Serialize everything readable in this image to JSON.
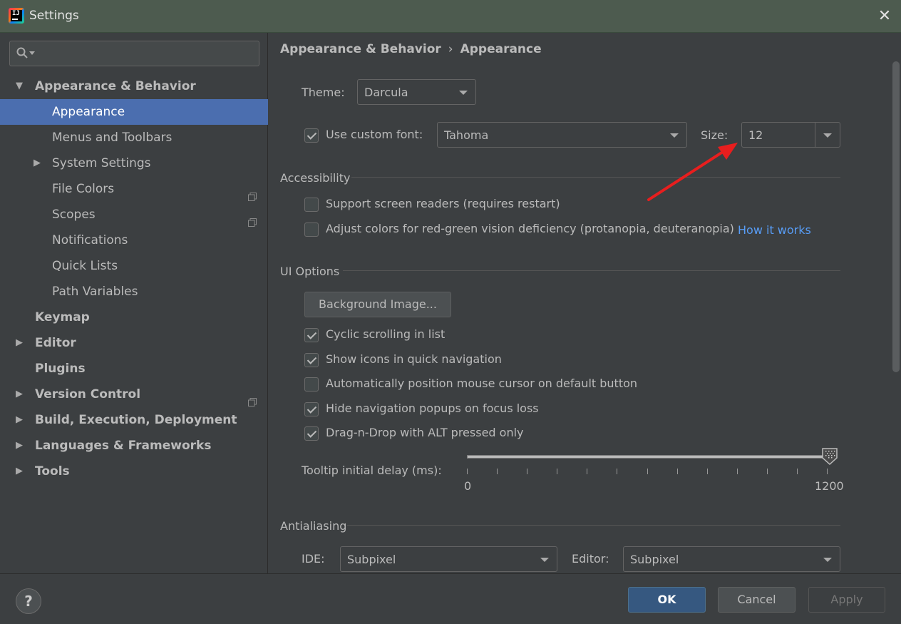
{
  "window": {
    "title": "Settings",
    "close_symbol": "✕"
  },
  "search": {
    "placeholder": ""
  },
  "sidebar": {
    "items": [
      {
        "label": "Appearance & Behavior",
        "level": 0,
        "bold": true,
        "arrow": "▼",
        "selected": false,
        "copy_icon": false
      },
      {
        "label": "Appearance",
        "level": 1,
        "bold": false,
        "arrow": "",
        "selected": true,
        "copy_icon": false
      },
      {
        "label": "Menus and Toolbars",
        "level": 1,
        "bold": false,
        "arrow": "",
        "selected": false,
        "copy_icon": false
      },
      {
        "label": "System Settings",
        "level": 1,
        "bold": false,
        "arrow": "▶",
        "selected": false,
        "copy_icon": false
      },
      {
        "label": "File Colors",
        "level": 1,
        "bold": false,
        "arrow": "",
        "selected": false,
        "copy_icon": true
      },
      {
        "label": "Scopes",
        "level": 1,
        "bold": false,
        "arrow": "",
        "selected": false,
        "copy_icon": true
      },
      {
        "label": "Notifications",
        "level": 1,
        "bold": false,
        "arrow": "",
        "selected": false,
        "copy_icon": false
      },
      {
        "label": "Quick Lists",
        "level": 1,
        "bold": false,
        "arrow": "",
        "selected": false,
        "copy_icon": false
      },
      {
        "label": "Path Variables",
        "level": 1,
        "bold": false,
        "arrow": "",
        "selected": false,
        "copy_icon": false
      },
      {
        "label": "Keymap",
        "level": 0,
        "bold": true,
        "arrow": "",
        "selected": false,
        "copy_icon": false
      },
      {
        "label": "Editor",
        "level": 0,
        "bold": true,
        "arrow": "▶",
        "selected": false,
        "copy_icon": false
      },
      {
        "label": "Plugins",
        "level": 0,
        "bold": true,
        "arrow": "",
        "selected": false,
        "copy_icon": false
      },
      {
        "label": "Version Control",
        "level": 0,
        "bold": true,
        "arrow": "▶",
        "selected": false,
        "copy_icon": true
      },
      {
        "label": "Build, Execution, Deployment",
        "level": 0,
        "bold": true,
        "arrow": "▶",
        "selected": false,
        "copy_icon": false
      },
      {
        "label": "Languages & Frameworks",
        "level": 0,
        "bold": true,
        "arrow": "▶",
        "selected": false,
        "copy_icon": false
      },
      {
        "label": "Tools",
        "level": 0,
        "bold": true,
        "arrow": "▶",
        "selected": false,
        "copy_icon": false
      }
    ]
  },
  "breadcrumb": {
    "parent": "Appearance & Behavior",
    "separator": "›",
    "current": "Appearance"
  },
  "theme": {
    "label": "Theme:",
    "value": "Darcula"
  },
  "font": {
    "checkbox_label": "Use custom font:",
    "checked": true,
    "value": "Tahoma",
    "size_label": "Size:",
    "size_value": "12"
  },
  "accessibility": {
    "title": "Accessibility",
    "screen_readers": {
      "label": "Support screen readers (requires restart)",
      "checked": false
    },
    "color_adjust": {
      "label": "Adjust colors for red-green vision deficiency (protanopia, deuteranopia)",
      "checked": false
    },
    "how_it_works": "How it works"
  },
  "ui_options": {
    "title": "UI Options",
    "background_button": "Background Image...",
    "cyclic_scrolling": {
      "label": "Cyclic scrolling in list",
      "checked": true
    },
    "show_icons": {
      "label": "Show icons in quick navigation",
      "checked": true
    },
    "auto_position": {
      "label": "Automatically position mouse cursor on default button",
      "checked": false
    },
    "hide_popups": {
      "label": "Hide navigation popups on focus loss",
      "checked": true
    },
    "drag_drop": {
      "label": "Drag-n-Drop with ALT pressed only",
      "checked": true
    },
    "tooltip": {
      "label": "Tooltip initial delay (ms):",
      "min_label": "0",
      "max_label": "1200",
      "value": 1200
    }
  },
  "antialiasing": {
    "title": "Antialiasing",
    "ide_label": "IDE:",
    "ide_value": "Subpixel",
    "editor_label": "Editor:",
    "editor_value": "Subpixel"
  },
  "footer": {
    "help": "?",
    "ok": "OK",
    "cancel": "Cancel",
    "apply": "Apply"
  },
  "colors": {
    "selection": "#4b6eaf",
    "link": "#589df6",
    "annotation_arrow": "#e81e1e",
    "primary_button": "#365880"
  }
}
